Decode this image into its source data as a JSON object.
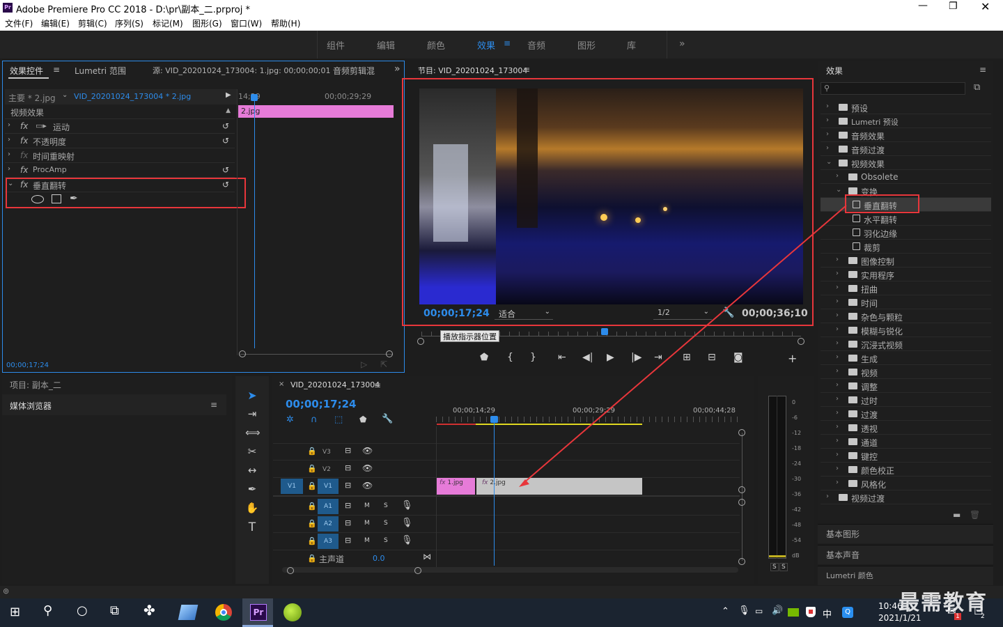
{
  "app": {
    "title": "Adobe Premiere Pro CC 2018 - D:\\pr\\副本_二.prproj *",
    "logo": "Pr"
  },
  "menu": [
    "文件(F)",
    "编辑(E)",
    "剪辑(C)",
    "序列(S)",
    "标记(M)",
    "图形(G)",
    "窗口(W)",
    "帮助(H)"
  ],
  "workspaces": [
    "组件",
    "编辑",
    "颜色",
    "效果",
    "音频",
    "图形",
    "库"
  ],
  "active_workspace": "效果",
  "effect_controls": {
    "tab": "效果控件",
    "tab2": "Lumetri 范围",
    "tab3": "源: VID_20201024_173004: 1.jpg: 00;00;00;01",
    "tab4": "音频剪辑混",
    "clip_main": "主要 * 2.jpg",
    "clip_seq": "VID_20201024_173004 * 2.jpg",
    "section": "视频效果",
    "effects": [
      "运动",
      "不透明度",
      "时间重映射",
      "ProcAmp",
      "垂直翻转"
    ],
    "timecode": "00;00;17;24",
    "ruler_a": "14;29",
    "ruler_b": "00;00;29;29",
    "clip_label": "2.jpg"
  },
  "program": {
    "title": "节目: VID_20201024_173004",
    "timecode": "00;00;17;24",
    "fit": "适合",
    "res": "1/2",
    "duration": "00;00;36;10",
    "tooltip": "播放指示器位置"
  },
  "effects_panel": {
    "title": "效果",
    "items": [
      {
        "label": "预设",
        "depth": 0,
        "kind": "preset",
        "open": false
      },
      {
        "label": "Lumetri 预设",
        "depth": 0,
        "kind": "preset",
        "open": false
      },
      {
        "label": "音频效果",
        "depth": 0,
        "kind": "folder",
        "open": false
      },
      {
        "label": "音频过渡",
        "depth": 0,
        "kind": "folder",
        "open": false
      },
      {
        "label": "视频效果",
        "depth": 0,
        "kind": "folder",
        "open": true
      },
      {
        "label": "Obsolete",
        "depth": 1,
        "kind": "folder",
        "open": false
      },
      {
        "label": "变换",
        "depth": 1,
        "kind": "folder",
        "open": true
      },
      {
        "label": "垂直翻转",
        "depth": 2,
        "kind": "effect",
        "selected": true
      },
      {
        "label": "水平翻转",
        "depth": 2,
        "kind": "effect"
      },
      {
        "label": "羽化边缘",
        "depth": 2,
        "kind": "effect"
      },
      {
        "label": "裁剪",
        "depth": 2,
        "kind": "effect"
      },
      {
        "label": "图像控制",
        "depth": 1,
        "kind": "folder",
        "open": false
      },
      {
        "label": "实用程序",
        "depth": 1,
        "kind": "folder",
        "open": false
      },
      {
        "label": "扭曲",
        "depth": 1,
        "kind": "folder",
        "open": false
      },
      {
        "label": "时间",
        "depth": 1,
        "kind": "folder",
        "open": false
      },
      {
        "label": "杂色与颗粒",
        "depth": 1,
        "kind": "folder",
        "open": false
      },
      {
        "label": "模糊与锐化",
        "depth": 1,
        "kind": "folder",
        "open": false
      },
      {
        "label": "沉浸式视频",
        "depth": 1,
        "kind": "folder",
        "open": false
      },
      {
        "label": "生成",
        "depth": 1,
        "kind": "folder",
        "open": false
      },
      {
        "label": "视频",
        "depth": 1,
        "kind": "folder",
        "open": false
      },
      {
        "label": "调整",
        "depth": 1,
        "kind": "folder",
        "open": false
      },
      {
        "label": "过时",
        "depth": 1,
        "kind": "folder",
        "open": false
      },
      {
        "label": "过渡",
        "depth": 1,
        "kind": "folder",
        "open": false
      },
      {
        "label": "透视",
        "depth": 1,
        "kind": "folder",
        "open": false
      },
      {
        "label": "通道",
        "depth": 1,
        "kind": "folder",
        "open": false
      },
      {
        "label": "键控",
        "depth": 1,
        "kind": "folder",
        "open": false
      },
      {
        "label": "颜色校正",
        "depth": 1,
        "kind": "folder",
        "open": false
      },
      {
        "label": "风格化",
        "depth": 1,
        "kind": "folder",
        "open": false
      },
      {
        "label": "视频过渡",
        "depth": 0,
        "kind": "folder",
        "open": false
      }
    ],
    "bottom": [
      "基本图形",
      "基本声音",
      "Lumetri 颜色"
    ]
  },
  "project": {
    "title": "项目: 副本_二",
    "browser": "媒体浏览器"
  },
  "timeline": {
    "title": "VID_20201024_173004",
    "timecode": "00;00;17;24",
    "ruler": [
      "00;00;14;29",
      "00;00;29;29",
      "00;00;44;28"
    ],
    "tracks_v": [
      "V3",
      "V2",
      "V1"
    ],
    "tracks_a": [
      "A1",
      "A2",
      "A3"
    ],
    "src_v": "V1",
    "master": "主声道",
    "master_val": "0.0",
    "clip1": "1.jpg",
    "clip2": "2.jpg"
  },
  "meter": {
    "labels": [
      "0",
      "-6",
      "-12",
      "-18",
      "-24",
      "-30",
      "-36",
      "-42",
      "-48",
      "-54",
      "dB"
    ],
    "solo": [
      "S",
      "S"
    ]
  },
  "taskbar": {
    "time": "10:46",
    "date": "2021/1/21",
    "ime": "中",
    "notif": "2",
    "badge": "1"
  },
  "watermark": "最需教育",
  "colors": {
    "accent": "#2d8ceb",
    "red_box": "#e8363b",
    "clip_pink": "#e67bd8",
    "clip_gray": "#c5c5c5",
    "playhead": "#2d8ceb"
  }
}
